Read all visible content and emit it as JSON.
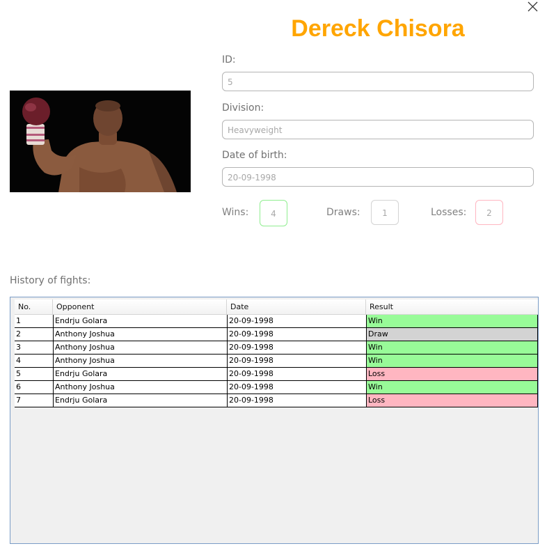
{
  "window": {
    "close_icon": "close-icon"
  },
  "fighter": {
    "name": "Dereck Chisora",
    "photo_subject": "boxer raising gloved fist",
    "id_label": "ID:",
    "id_value": "5",
    "division_label": "Division:",
    "division_value": "Heavyweight",
    "dob_label": "Date of birth:",
    "dob_value": "20-09-1998"
  },
  "record": {
    "wins_label": "Wins:",
    "wins": "4",
    "draws_label": "Draws:",
    "draws": "1",
    "losses_label": "Losses:",
    "losses": "2"
  },
  "history": {
    "label": "History of fights:",
    "columns": [
      "No.",
      "Opponent",
      "Date",
      "Result"
    ],
    "rows": [
      {
        "no": "1",
        "opponent": "Endrju Golara",
        "date": "20-09-1998",
        "result": "Win"
      },
      {
        "no": "2",
        "opponent": "Anthony Joshua",
        "date": "20-09-1998",
        "result": "Draw"
      },
      {
        "no": "3",
        "opponent": "Anthony Joshua",
        "date": "20-09-1998",
        "result": "Win"
      },
      {
        "no": "4",
        "opponent": "Anthony Joshua",
        "date": "20-09-1998",
        "result": "Win"
      },
      {
        "no": "5",
        "opponent": "Endrju Golara",
        "date": "20-09-1998",
        "result": "Loss"
      },
      {
        "no": "6",
        "opponent": "Anthony Joshua",
        "date": "20-09-1998",
        "result": "Win"
      },
      {
        "no": "7",
        "opponent": "Endrju Golara",
        "date": "20-09-1998",
        "result": "Loss"
      }
    ]
  },
  "colors": {
    "title": "#FFA500",
    "win": "#98FB98",
    "loss": "#FFB6C1",
    "draw": "#D3D3D3",
    "wins_border": "#90EE90",
    "draws_border": "#D3D3D3",
    "losses_border": "#FFB6C1"
  }
}
